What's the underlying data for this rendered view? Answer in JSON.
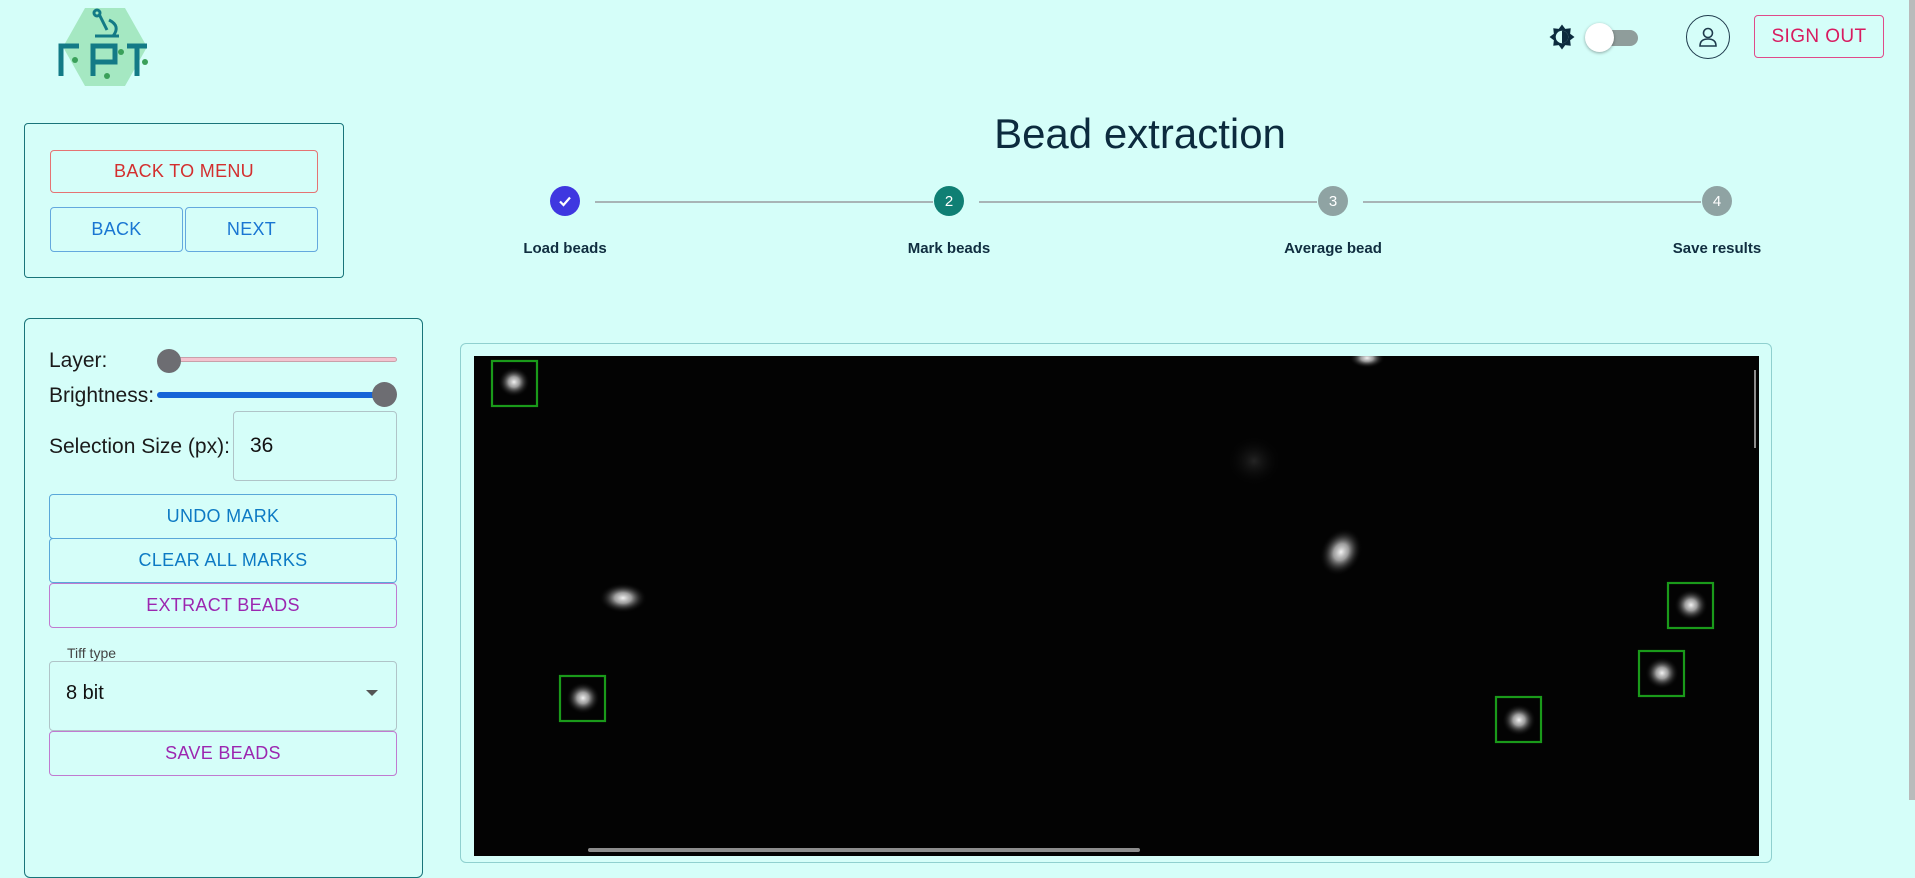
{
  "header": {
    "logo_text": "FRT",
    "theme_toggle": {
      "icon": "brightness-icon",
      "state": "off"
    },
    "user_icon": "account-icon",
    "sign_out_label": "SIGN OUT"
  },
  "nav": {
    "back_to_menu_label": "BACK TO MENU",
    "back_label": "BACK",
    "next_label": "NEXT"
  },
  "page_title": "Bead extraction",
  "stepper": {
    "steps": [
      {
        "number": "1",
        "label": "Load beads",
        "status": "completed"
      },
      {
        "number": "2",
        "label": "Mark beads",
        "status": "active"
      },
      {
        "number": "3",
        "label": "Average bead",
        "status": "pending"
      },
      {
        "number": "4",
        "label": "Save results",
        "status": "pending"
      }
    ],
    "colors": {
      "completed": "#3f37e0",
      "active": "#0f7f74",
      "pending": "#8fa3a3"
    }
  },
  "controls": {
    "layer_label": "Layer:",
    "layer_value_fraction": 0.0,
    "brightness_label": "Brightness:",
    "brightness_value_fraction": 1.0,
    "selection_size_label": "Selection Size (px):",
    "selection_size_value": "36",
    "undo_label": "UNDO MARK",
    "clear_label": "CLEAR ALL MARKS",
    "extract_label": "EXTRACT BEADS",
    "tiff_type_label": "Tiff type",
    "tiff_type_value": "8 bit",
    "save_label": "SAVE BEADS"
  },
  "colors": {
    "background": "#d5fef9",
    "panel_border": "#19747a",
    "mark_color": "#1a9a1a",
    "image_background": "#030303"
  }
}
